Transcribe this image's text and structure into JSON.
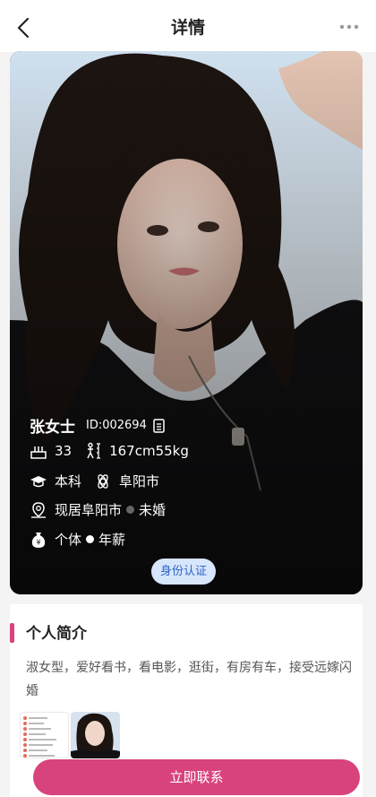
{
  "header": {
    "title": "详情"
  },
  "profile": {
    "name": "张女士",
    "id_text": "ID:002694",
    "age": "33",
    "height_weight": "167cm55kg",
    "education": "本科",
    "hometown": "阜阳市",
    "residence": "现居阜阳市",
    "marital_status": "未婚",
    "occupation": "个体",
    "income_label": "年薪",
    "verify_badge": "身份认证"
  },
  "intro_section": {
    "title": "个人简介",
    "text": "淑女型，爱好看书，看电影，逛街，有房有车，接受远嫁闪婚"
  },
  "actions": {
    "contact_label": "立即联系"
  },
  "colors": {
    "accent": "#d8437e",
    "badge_bg": "#d7e6fb",
    "badge_text": "#2e64c7"
  }
}
